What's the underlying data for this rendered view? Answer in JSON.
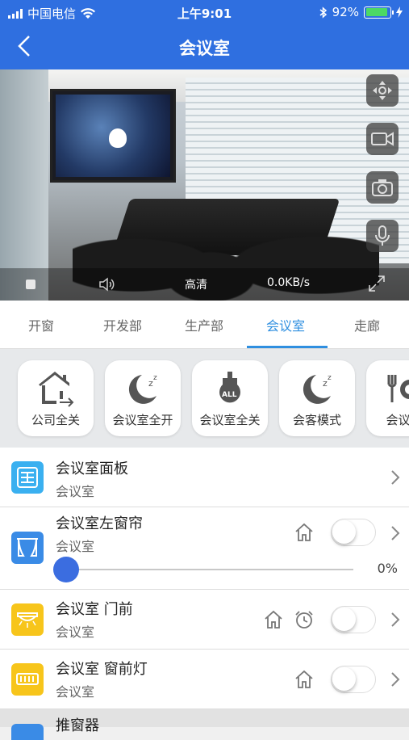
{
  "status_bar": {
    "carrier": "中国电信",
    "time": "上午9:01",
    "battery": "92%"
  },
  "nav": {
    "title": "会议室"
  },
  "video": {
    "quality": "高清",
    "rate": "0.0KB/s"
  },
  "tabs": [
    {
      "label": "开窗"
    },
    {
      "label": "开发部"
    },
    {
      "label": "生产部"
    },
    {
      "label": "会议室",
      "active": true
    },
    {
      "label": "走廊"
    }
  ],
  "scenes": [
    {
      "label": "公司全关",
      "icon": "house-exit-icon"
    },
    {
      "label": "会议室全开",
      "icon": "moon-zz-icon"
    },
    {
      "label": "会议室全关",
      "icon": "bulb-all-icon"
    },
    {
      "label": "会客模式",
      "icon": "moon-zz-icon"
    },
    {
      "label": "会议模",
      "icon": "dining-icon"
    }
  ],
  "devices": [
    {
      "name": "会议室面板",
      "room": "会议室",
      "icon": "panel-icon",
      "color": "#3ab0f0"
    },
    {
      "name": "会议室左窗帘",
      "room": "会议室",
      "icon": "curtain-icon",
      "color": "#3a8be6",
      "percent": "0%",
      "level": 0
    },
    {
      "name": "会议室 门前",
      "room": "会议室",
      "icon": "ceiling-light-icon",
      "color": "#f7c51b"
    },
    {
      "name": "会议室 窗前灯",
      "room": "会议室",
      "icon": "strip-light-icon",
      "color": "#f7c51b"
    }
  ],
  "partial_row": {
    "name": "推窗器"
  },
  "colors": {
    "accent": "#2f6fe0",
    "tab_active": "#2f8fe0",
    "slider": "#3b6de0"
  }
}
